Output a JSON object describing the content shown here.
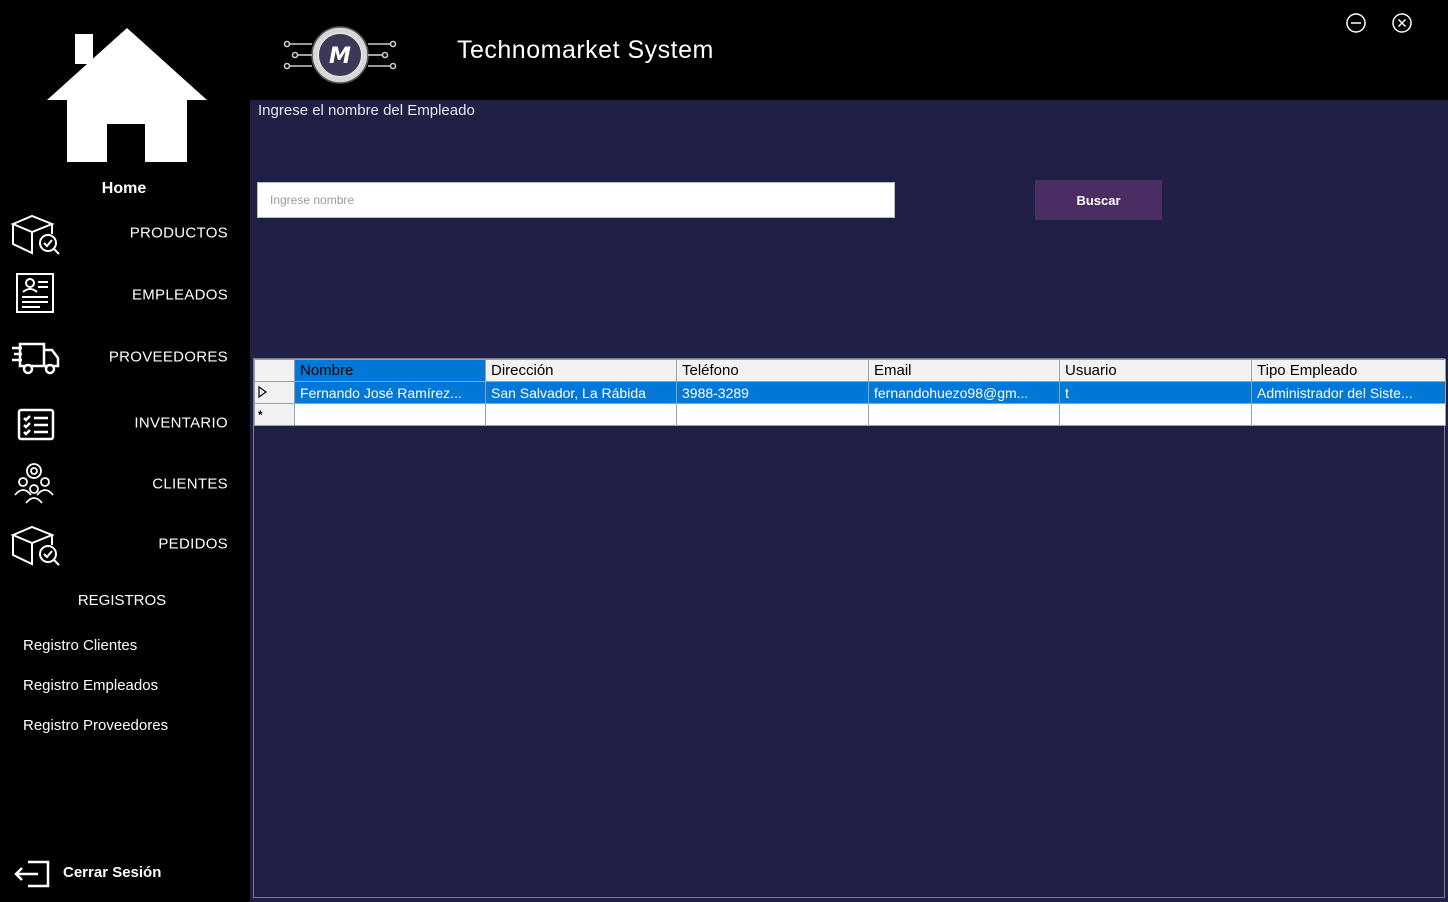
{
  "app": {
    "title": "Technomarket System"
  },
  "sidebar": {
    "home_label": "Home",
    "nav": [
      {
        "label": "PRODUCTOS",
        "icon": "package-check-icon"
      },
      {
        "label": "EMPLEADOS",
        "icon": "employee-document-icon"
      },
      {
        "label": "PROVEEDORES",
        "icon": "delivery-truck-icon"
      },
      {
        "label": "INVENTARIO",
        "icon": "checklist-icon"
      },
      {
        "label": "CLIENTES",
        "icon": "customers-icon"
      },
      {
        "label": "PEDIDOS",
        "icon": "package-check-icon"
      }
    ],
    "registros_title": "REGISTROS",
    "registros": [
      "Registro Clientes",
      "Registro Empleados",
      "Registro Proveedores"
    ],
    "logout_label": "Cerrar Sesión"
  },
  "search": {
    "prompt": "Ingrese el nombre del Empleado",
    "placeholder": "Ingrese nombre",
    "value": "",
    "button_label": "Buscar"
  },
  "table": {
    "columns": [
      "Nombre",
      "Dirección",
      "Teléfono",
      "Email",
      "Usuario",
      "Tipo Empleado"
    ],
    "selected_column": "Nombre",
    "rows": [
      [
        "Fernando José Ramírez...",
        "San Salvador, La Rábida",
        "3988-3289",
        "fernandohuezo98@gm...",
        "t",
        "Administrador del Siste..."
      ]
    ],
    "new_row_marker": "*"
  },
  "colors": {
    "content_bg": "#202047",
    "button_bg": "#4a2e63",
    "selection": "#0078d7"
  }
}
